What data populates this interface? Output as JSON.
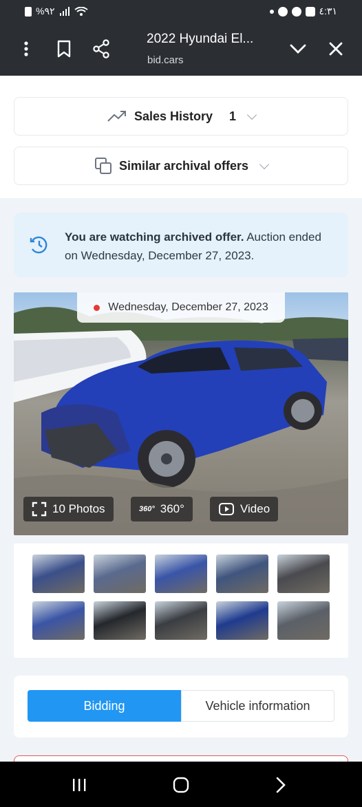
{
  "status_bar": {
    "left_text": "%۹۲",
    "time": "٤:٣١"
  },
  "app_bar": {
    "title": "2022 Hyundai El...",
    "url": "bid.cars",
    "icons": [
      "more-vert-icon",
      "bookmark-icon",
      "share-icon",
      "chevron-down-icon",
      "close-icon"
    ]
  },
  "sales_history": {
    "label": "Sales History",
    "count": "1"
  },
  "similar_offers": {
    "label": "Similar archival offers"
  },
  "notice": {
    "bold_text": "You are watching archived offer.",
    "text": " Auction ended on Wednesday, December 27, 2023."
  },
  "photo": {
    "date": "Wednesday, December 27, 2023",
    "photos_label": "10 Photos",
    "tour_label": "360°",
    "video_label": "Video",
    "tour_icon_text": "360°"
  },
  "thumbnails": {
    "count": 10,
    "colors": [
      "#3b4f8a",
      "#5a6a8e",
      "#3a55a8",
      "#40557e",
      "#4a4a4f",
      "#3b55a6",
      "#24272c",
      "#3a3d42",
      "#1f3b8f",
      "#5b6068"
    ]
  },
  "tabs": {
    "active": "Bidding",
    "inactive": "Vehicle information"
  },
  "colors": {
    "accent": "#2196f3",
    "notice_bg": "#e5f1fb",
    "car_blue": "#2340b8"
  }
}
